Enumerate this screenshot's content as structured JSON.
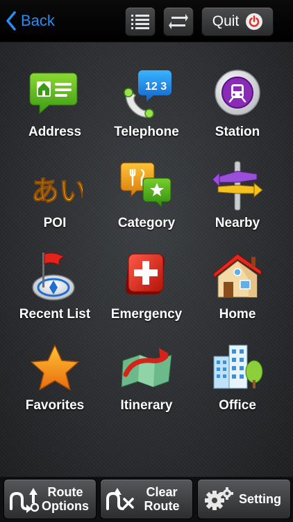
{
  "header": {
    "back_label": "Back",
    "quit_label": "Quit"
  },
  "menu": [
    {
      "label": "Address",
      "icon": "address-icon"
    },
    {
      "label": "Telephone",
      "icon": "telephone-icon"
    },
    {
      "label": "Station",
      "icon": "station-icon"
    },
    {
      "label": "POI",
      "icon": "poi-icon"
    },
    {
      "label": "Category",
      "icon": "category-icon"
    },
    {
      "label": "Nearby",
      "icon": "nearby-icon"
    },
    {
      "label": "Recent List",
      "icon": "recent-list-icon"
    },
    {
      "label": "Emergency",
      "icon": "emergency-icon"
    },
    {
      "label": "Home",
      "icon": "home-icon"
    },
    {
      "label": "Favorites",
      "icon": "favorites-icon"
    },
    {
      "label": "Itinerary",
      "icon": "itinerary-icon"
    },
    {
      "label": "Office",
      "icon": "office-icon"
    }
  ],
  "footer": {
    "route_options_label": "Route\nOptions",
    "clear_route_label": "Clear\nRoute",
    "setting_label": "Setting"
  },
  "poi_glyphs": "あい",
  "telephone_glyphs": "12 3",
  "colors": {
    "accent": "#2b8cf0",
    "background": "#2b2d30"
  }
}
